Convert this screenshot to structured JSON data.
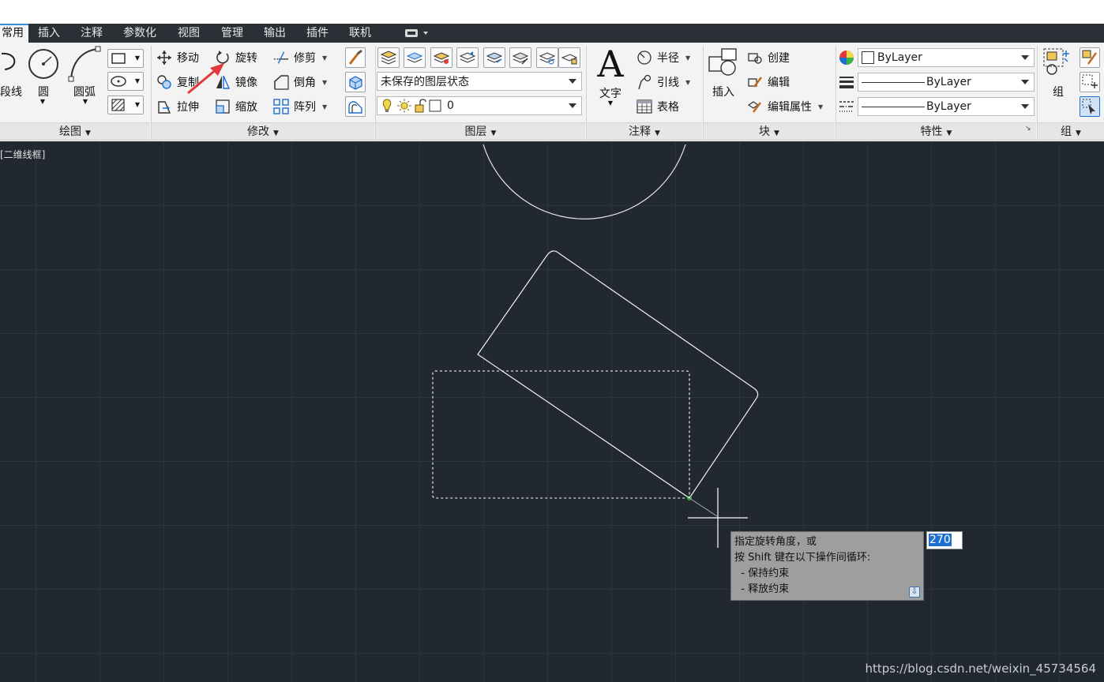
{
  "tabs": [
    "常用",
    "插入",
    "注释",
    "参数化",
    "视图",
    "管理",
    "输出",
    "插件",
    "联机"
  ],
  "draw_panel": {
    "title": "绘图",
    "polyline_label": "段线",
    "circle_label": "圆",
    "arc_label": "圆弧"
  },
  "modify_panel": {
    "title": "修改",
    "move": "移动",
    "rotate": "旋转",
    "trim": "修剪",
    "copy": "复制",
    "mirror": "镜像",
    "fillet": "倒角",
    "stretch": "拉伸",
    "scale": "缩放",
    "array": "阵列"
  },
  "layers_panel": {
    "title": "图层",
    "layer_state": "未保存的图层状态",
    "current_layer": "0"
  },
  "annotation_panel": {
    "title": "注释",
    "text": "文字",
    "radius": "半径",
    "leader": "引线",
    "table": "表格"
  },
  "block_panel": {
    "title": "块",
    "insert": "插入",
    "create": "创建",
    "edit": "编辑",
    "edit_attributes": "编辑属性"
  },
  "properties_panel": {
    "title": "特性",
    "color": "ByLayer",
    "linetype": "ByLayer",
    "lineweight": "ByLayer"
  },
  "group_panel": {
    "title": "组",
    "group": "组"
  },
  "viewport": {
    "label": "[二维线框]"
  },
  "command_tooltip": {
    "line1": "指定旋转角度，或",
    "line2": "按 Shift 键在以下操作间循环:",
    "line3": "  - 保持约束",
    "line4": "  - 释放约束",
    "input_value": "270"
  },
  "watermark": "https://blog.csdn.net/weixin_45734564",
  "colors": {
    "canvas": "#212830",
    "accent": "#1e6fd0",
    "arrow": "#e23a3a"
  }
}
